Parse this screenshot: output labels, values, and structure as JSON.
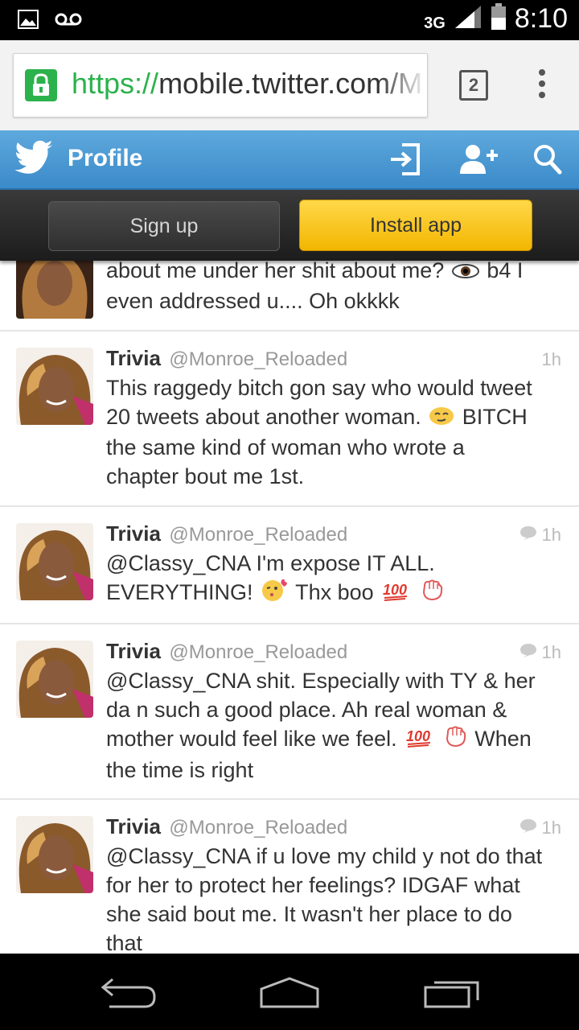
{
  "status_bar": {
    "network": "3G",
    "time": "8:10",
    "icons": [
      "image-icon",
      "voicemail-icon",
      "signal-icon",
      "battery-icon"
    ]
  },
  "browser": {
    "url_scheme": "https://",
    "url_host": "mobile.twitter.com/M",
    "tab_count": "2",
    "accent": "#2bb24c"
  },
  "twitter_header": {
    "title": "Profile",
    "color": "#4a9ad5"
  },
  "promo": {
    "signup_label": "Sign up",
    "install_label": "Install app"
  },
  "tweets": [
    {
      "line1": "about me under her shit about me?",
      "line1_tail": "b4 I",
      "line2": "even addressed u.... Oh okkkk"
    },
    {
      "name": "Trivia",
      "handle": "@Monroe_Reloaded",
      "time": "1h",
      "line1": "This raggedy bitch gon say who would tweet",
      "line2a": "20 tweets about another woman.",
      "line2b": "BITCH",
      "line3": "the same kind of woman who wrote a",
      "line4": "chapter bout me 1st."
    },
    {
      "name": "Trivia",
      "handle": "@Monroe_Reloaded",
      "time": "1h",
      "line1": "@Classy_CNA I'm expose IT ALL.",
      "line2a": "EVERYTHING!",
      "line2b": "Thx boo"
    },
    {
      "name": "Trivia",
      "handle": "@Monroe_Reloaded",
      "time": "1h",
      "line1": "@Classy_CNA shit. Especially with TY & her",
      "line2": "da n such a good place. Ah real woman &",
      "line3a": "mother would feel like we feel.",
      "line3b": "When",
      "line4": "the time is right"
    },
    {
      "name": "Trivia",
      "handle": "@Monroe_Reloaded",
      "time": "1h",
      "line1": "@Classy_CNA if u love my child y not do that",
      "line2": "for her to protect her feelings? IDGAF what",
      "line3": "she said bout me. It wasn't her place to do",
      "line4": "that"
    }
  ],
  "nav_bar": {
    "buttons": [
      "back-icon",
      "home-icon",
      "recent-apps-icon"
    ]
  }
}
